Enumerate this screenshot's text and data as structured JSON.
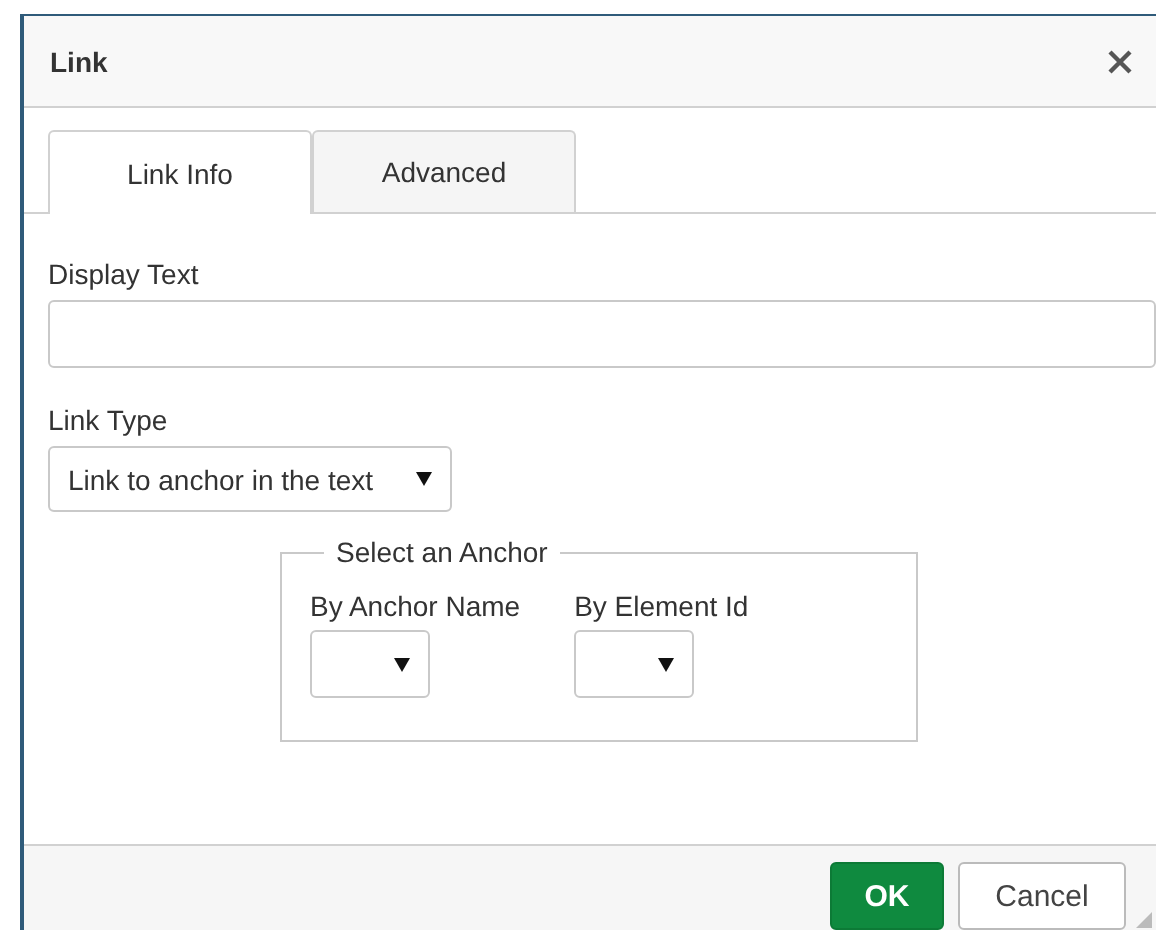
{
  "window": {
    "title": "Link"
  },
  "tabs": [
    {
      "label": "Link Info",
      "selected": true
    },
    {
      "label": "Advanced",
      "selected": false
    }
  ],
  "display_text": {
    "label": "Display Text"
  },
  "link_type": {
    "label": "Link Type",
    "value": "Link to anchor in the text"
  },
  "anchor_group": {
    "legend": "Select an Anchor",
    "fields": [
      {
        "label": "By Anchor Name"
      },
      {
        "label": "By Element Id"
      }
    ]
  },
  "buttons": [
    {
      "label": "OK",
      "kind": "primary"
    },
    {
      "label": "Cancel",
      "kind": "secondary"
    }
  ]
}
